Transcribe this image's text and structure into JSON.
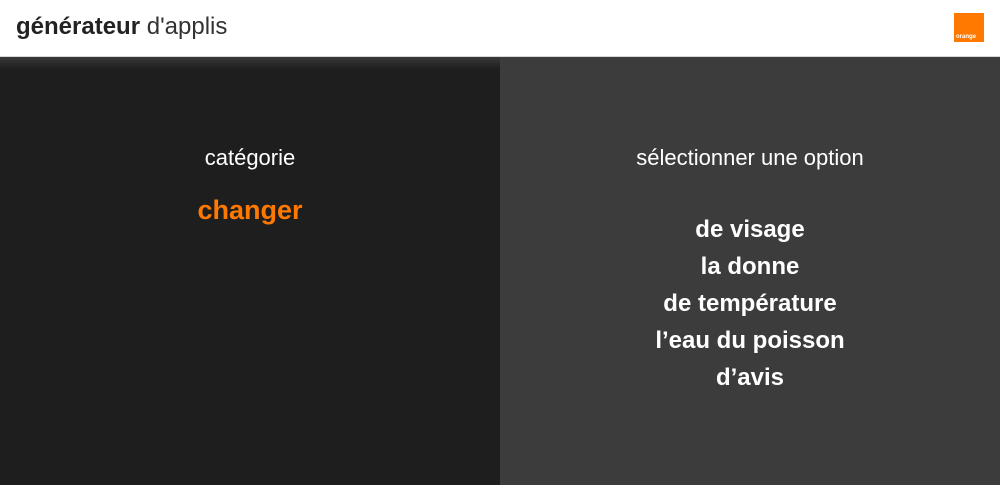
{
  "header": {
    "title_bold": "générateur",
    "title_light": "d'applis",
    "logo_text": "orange"
  },
  "left_panel": {
    "label": "catégorie",
    "value": "changer"
  },
  "right_panel": {
    "label": "sélectionner une option",
    "options": [
      "de visage",
      "la donne",
      "de température",
      "l’eau du poisson",
      "d’avis"
    ]
  },
  "colors": {
    "accent": "#ff7900",
    "left_bg": "#1e1e1e",
    "right_bg": "#3c3c3c",
    "header_bg": "#ffffff"
  }
}
